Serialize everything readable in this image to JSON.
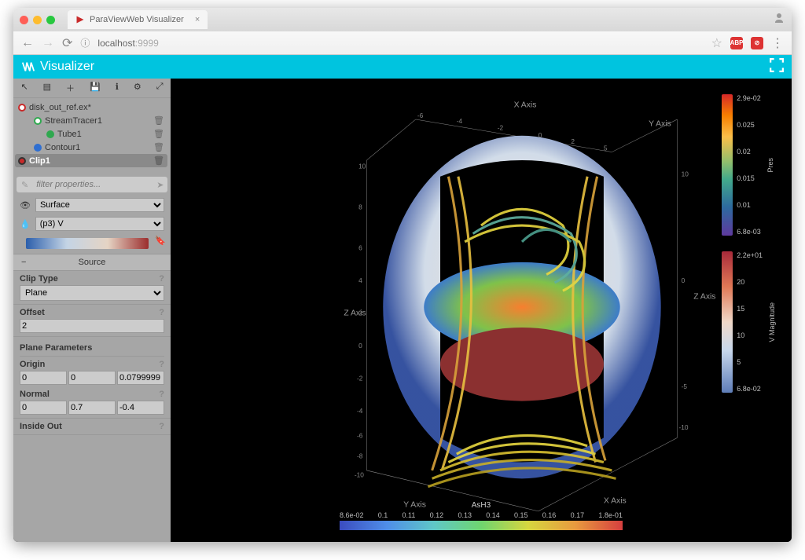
{
  "browser": {
    "tab_title": "ParaViewWeb Visualizer",
    "url_host": "localhost",
    "url_port": ":9999"
  },
  "app": {
    "title": "Visualizer"
  },
  "tree": {
    "items": [
      {
        "label": "disk_out_ref.ex*",
        "color": "#c92a2a",
        "indent": 0,
        "del": false,
        "ring": true
      },
      {
        "label": "StreamTracer1",
        "color": "#2fa84f",
        "indent": 1,
        "del": true,
        "ring": true
      },
      {
        "label": "Tube1",
        "color": "#2fa84f",
        "indent": 2,
        "del": true,
        "ring": false
      },
      {
        "label": "Contour1",
        "color": "#2f6fd1",
        "indent": 1,
        "del": true,
        "ring": false
      },
      {
        "label": "Clip1",
        "color": "#c92a2a",
        "indent": 0,
        "del": true,
        "sel": true,
        "ring": false
      }
    ]
  },
  "filter_placeholder": "filter properties...",
  "representation": {
    "mode": "Surface",
    "color_by": "(p3) V"
  },
  "source": {
    "header": "Source",
    "clip_type": {
      "label": "Clip Type",
      "value": "Plane"
    },
    "offset": {
      "label": "Offset",
      "value": "2"
    },
    "plane_params": "Plane Parameters",
    "origin": {
      "label": "Origin",
      "x": "0",
      "y": "0",
      "z": "0.0799999"
    },
    "normal": {
      "label": "Normal",
      "x": "0",
      "y": "0.7",
      "z": "-0.4"
    },
    "inside_out": "Inside Out"
  },
  "axes": {
    "x": "X Axis",
    "y": "Y Axis",
    "z": "Z Axis"
  },
  "colorbars": {
    "pres": {
      "title": "Pres",
      "ticks": [
        "2.9e-02",
        "0.025",
        "0.02",
        "0.015",
        "0.01",
        "6.8e-03"
      ]
    },
    "vmag": {
      "title": "V Magnitude",
      "ticks": [
        "2.2e+01",
        "20",
        "15",
        "10",
        "5",
        "6.8e-02"
      ]
    },
    "ash3": {
      "title": "AsH3",
      "ticks": [
        "8.6e-02",
        "0.1",
        "0.11",
        "0.12",
        "0.13",
        "0.14",
        "0.15",
        "0.16",
        "0.17",
        "1.8e-01"
      ]
    }
  }
}
